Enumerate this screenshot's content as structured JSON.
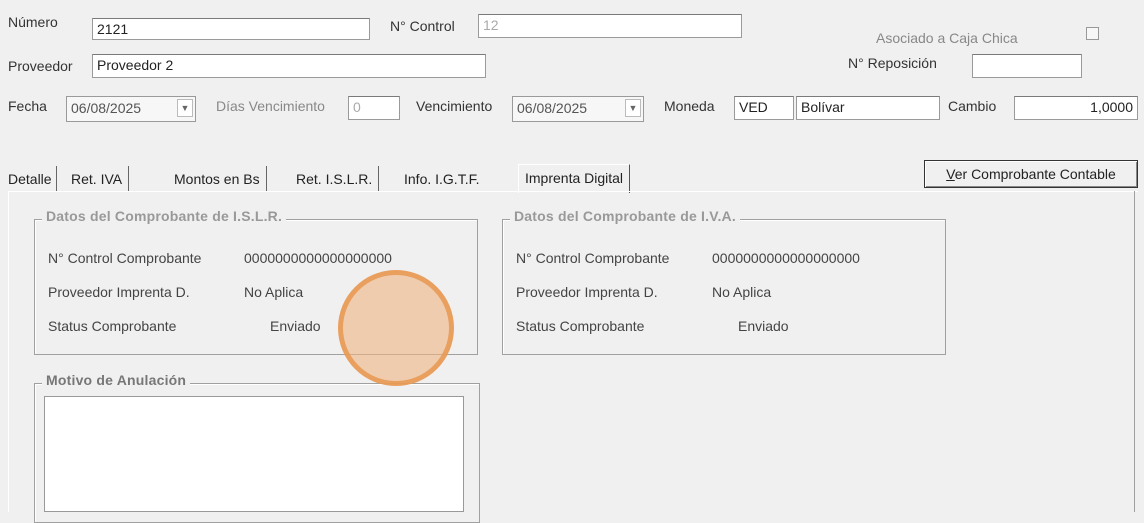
{
  "header": {
    "numero_label": "Número",
    "numero_value": "2121",
    "control_label": "N° Control",
    "control_value": "12",
    "caja_chica_label": "Asociado a Caja Chica",
    "proveedor_label": "Proveedor",
    "proveedor_value": "Proveedor 2",
    "reposicion_label": "N° Reposición",
    "reposicion_value": "",
    "fecha_label": "Fecha",
    "fecha_value": "06/08/2025",
    "dias_label": "Días Vencimiento",
    "dias_value": "0",
    "vencimiento_label": "Vencimiento",
    "vencimiento_value": "06/08/2025",
    "moneda_label": "Moneda",
    "moneda_code": "VED",
    "moneda_name": "Bolívar",
    "cambio_label": "Cambio",
    "cambio_value": "1,0000"
  },
  "tabs": [
    {
      "label": "Detalle"
    },
    {
      "label": "Ret. IVA"
    },
    {
      "label": "Montos en Bs"
    },
    {
      "label": "Ret. I.S.L.R."
    },
    {
      "label": "Info. I.G.T.F."
    },
    {
      "label": "Imprenta Digital",
      "active": true
    }
  ],
  "ver_comprobante": {
    "underline": "V",
    "rest": "er Comprobante Contable"
  },
  "islr": {
    "title": "Datos del Comprobante de I.S.L.R.",
    "control_label": "N° Control Comprobante",
    "control_value": "0000000000000000000",
    "imprenta_label": "Proveedor Imprenta D.",
    "imprenta_value": "No Aplica",
    "status_label": "Status Comprobante",
    "status_value": "Enviado"
  },
  "iva": {
    "title": "Datos del Comprobante de I.V.A.",
    "control_label": "N° Control Comprobante",
    "control_value": "0000000000000000000",
    "imprenta_label": "Proveedor Imprenta D.",
    "imprenta_value": "No Aplica",
    "status_label": "Status Comprobante",
    "status_value": "Enviado"
  },
  "anulacion": {
    "title": "Motivo de Anulación",
    "value": ""
  }
}
